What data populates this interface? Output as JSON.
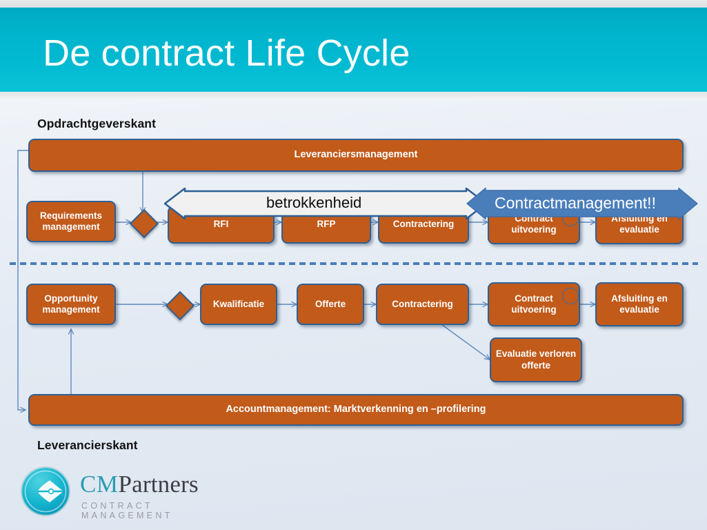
{
  "header": {
    "title": "De contract Life Cycle"
  },
  "captions": {
    "top": "Opdrachtgeverskant",
    "bottom": "Leverancierskant"
  },
  "colors": {
    "banner_teal": "#00b5cd",
    "box_orange": "#c25a1a",
    "box_border_blue": "#2e6094",
    "connector_blue": "#4a7ebb",
    "arrow_blue": "#4a7ebb",
    "arrow_white": "#f2f2f2",
    "text_white": "#ffffff",
    "text_dark": "#0d0d0d"
  },
  "bars": {
    "supplier_management": "Leveranciersmanagement",
    "account_management": "Accountmanagement: Marktverkenning en –profilering"
  },
  "big_arrows": [
    {
      "name": "betrokkenheid",
      "label": "betrokkenheid",
      "style": "white-outline",
      "direction": "double"
    },
    {
      "name": "contractmanagement",
      "label": "Contractmanagement!!",
      "style": "solid-blue",
      "direction": "double"
    }
  ],
  "row_buyer": {
    "boxes": [
      {
        "id": "requirements-management",
        "label": "Requirements management"
      },
      {
        "id": "rfi",
        "label": "RFI"
      },
      {
        "id": "rfp",
        "label": "RFP"
      },
      {
        "id": "contractering",
        "label": "Contractering"
      },
      {
        "id": "contract-uitvoering",
        "label": "Contract uitvoering",
        "decoration": "circle"
      },
      {
        "id": "afsluiting-en-evaluatie",
        "label": "Afsluiting en evaluatie"
      }
    ]
  },
  "row_supplier": {
    "boxes": [
      {
        "id": "opportunity-management",
        "label": "Opportunity management"
      },
      {
        "id": "kwalificatie",
        "label": "Kwalificatie"
      },
      {
        "id": "offerte",
        "label": "Offerte"
      },
      {
        "id": "contractering",
        "label": "Contractering"
      },
      {
        "id": "contract-uitvoering",
        "label": "Contract uitvoering",
        "decoration": "circle"
      },
      {
        "id": "afsluiting-en-evaluatie",
        "label": "Afsluiting en evaluatie"
      },
      {
        "id": "evaluatie-verloren-offerte",
        "label": "Evaluatie verloren offerte"
      }
    ]
  },
  "logo": {
    "name": "CM Partners",
    "word_cm": "CM",
    "word_partners": "Partners",
    "tagline": "CONTRACT MANAGEMENT"
  }
}
